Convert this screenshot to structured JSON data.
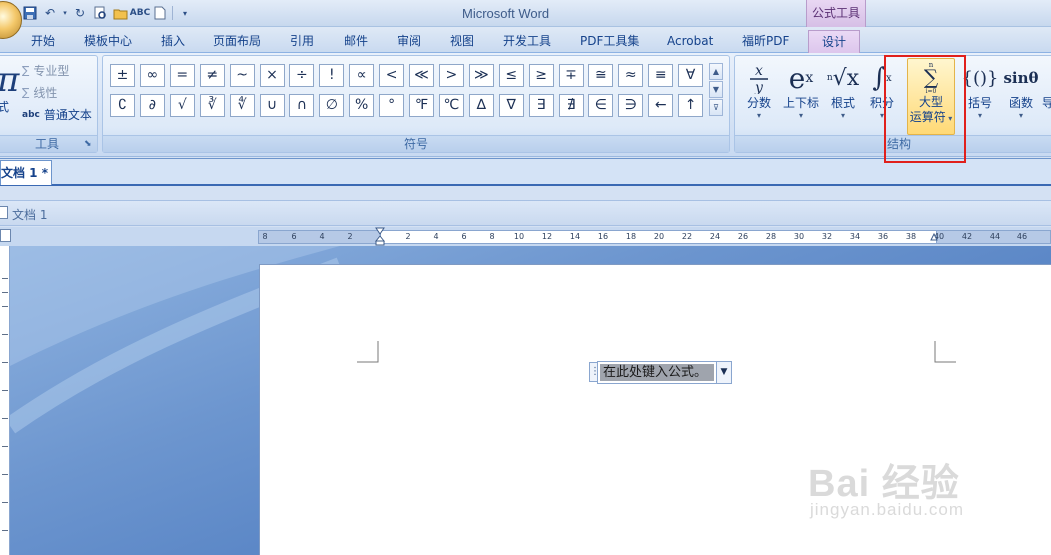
{
  "titlebar": {
    "app_title": "Microsoft Word",
    "context_title": "公式工具"
  },
  "tabs": [
    {
      "label": "开始"
    },
    {
      "label": "模板中心"
    },
    {
      "label": "插入"
    },
    {
      "label": "页面布局"
    },
    {
      "label": "引用"
    },
    {
      "label": "邮件"
    },
    {
      "label": "审阅"
    },
    {
      "label": "视图"
    },
    {
      "label": "开发工具"
    },
    {
      "label": "PDF工具集"
    },
    {
      "label": "Acrobat"
    },
    {
      "label": "福昕PDF"
    },
    {
      "label": "设计"
    }
  ],
  "tools_group": {
    "label": "工具",
    "pi_label": "式",
    "professional": "专业型",
    "linear": "线性",
    "normal_text": "普通文本",
    "abc": "abc"
  },
  "symbols_group": {
    "label": "符号",
    "row1": [
      "±",
      "∞",
      "=",
      "≠",
      "~",
      "×",
      "÷",
      "!",
      "∝",
      "<",
      "≪",
      ">",
      "≫",
      "≤",
      "≥",
      "∓",
      "≅",
      "≈",
      "≡",
      "∀"
    ],
    "row2": [
      "∁",
      "∂",
      "√",
      "∛",
      "∜",
      "∪",
      "∩",
      "∅",
      "%",
      "°",
      "℉",
      "℃",
      "∆",
      "∇",
      "∃",
      "∄",
      "∈",
      "∋",
      "←",
      "↑"
    ]
  },
  "structures_group": {
    "label": "结构",
    "items": [
      {
        "label": "分数"
      },
      {
        "label": "上下标"
      },
      {
        "label": "根式"
      },
      {
        "label": "积分"
      },
      {
        "label1": "大型",
        "label2": "运算符"
      },
      {
        "label": "括号"
      },
      {
        "label": "函数"
      },
      {
        "label": "导"
      }
    ]
  },
  "document": {
    "tab_label": "文档 1 *",
    "window_title": "文档 1",
    "equation_placeholder": "在此处键入公式。"
  },
  "ruler": {
    "ticks": [
      "8",
      "6",
      "4",
      "2",
      "2",
      "4",
      "6",
      "8",
      "10",
      "12",
      "14",
      "16",
      "18",
      "20",
      "22",
      "24",
      "26",
      "28",
      "30",
      "32",
      "34",
      "36",
      "38",
      "40",
      "42",
      "44",
      "46"
    ]
  },
  "watermark": {
    "main": "Bai  经验",
    "sub": "jingyan.baidu.com"
  }
}
